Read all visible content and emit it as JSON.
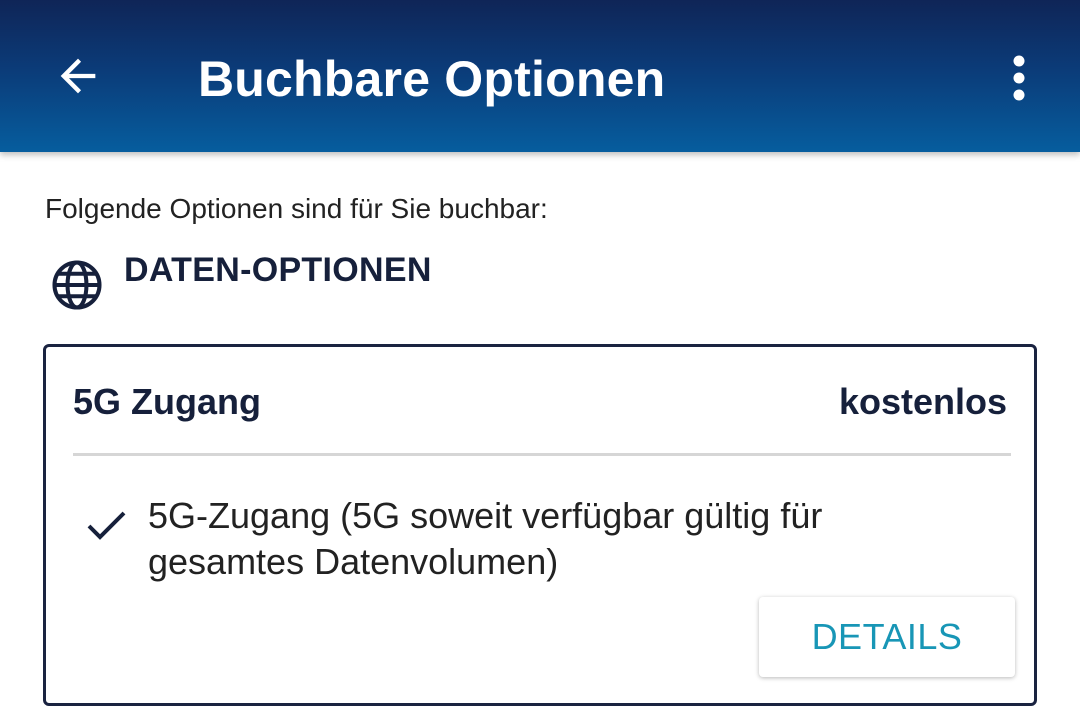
{
  "appbar": {
    "title": "Buchbare Optionen",
    "back_icon": "arrow-left-icon",
    "menu_icon": "more-vertical-icon",
    "gradient_colors": [
      "#0f2557",
      "#065d9e"
    ]
  },
  "intro_text": "Folgende Optionen sind für Sie buchbar:",
  "section": {
    "icon": "globe-icon",
    "title": "DATEN-OPTIONEN"
  },
  "option_card": {
    "name": "5G Zugang",
    "price": "kostenlos",
    "feature_icon": "checkmark-icon",
    "feature_text": "5G-Zugang (5G soweit verfügbar gültig für gesamtes Datenvolumen)",
    "details_label": "DETAILS",
    "accent_color": "#1896b6"
  }
}
